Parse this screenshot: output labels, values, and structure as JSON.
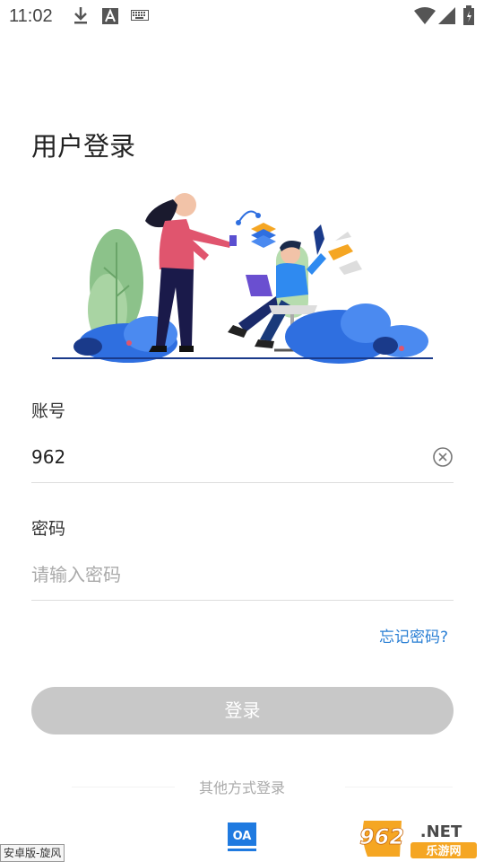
{
  "status_bar": {
    "time": "11:02",
    "icons": [
      "download-icon",
      "font-a-icon",
      "keyboard-icon",
      "wifi-icon",
      "signal-icon",
      "battery-icon"
    ]
  },
  "page": {
    "title": "用户登录"
  },
  "account": {
    "label": "账号",
    "value": "962"
  },
  "password": {
    "label": "密码",
    "placeholder": "请输入密码"
  },
  "forgot_password": "忘记密码?",
  "login_button": "登录",
  "other_methods": {
    "label": "其他方式登录",
    "oa_label": "OA"
  },
  "watermark": {
    "left_text": "安卓版-旋风",
    "right_logo": "962",
    "right_suffix": ".NET",
    "right_sub": "乐游网"
  },
  "colors": {
    "accent": "#2a7fd4",
    "button_disabled": "#c8c8c8",
    "illustration_blue": "#2f6fe0",
    "illustration_pink": "#e0556e"
  }
}
